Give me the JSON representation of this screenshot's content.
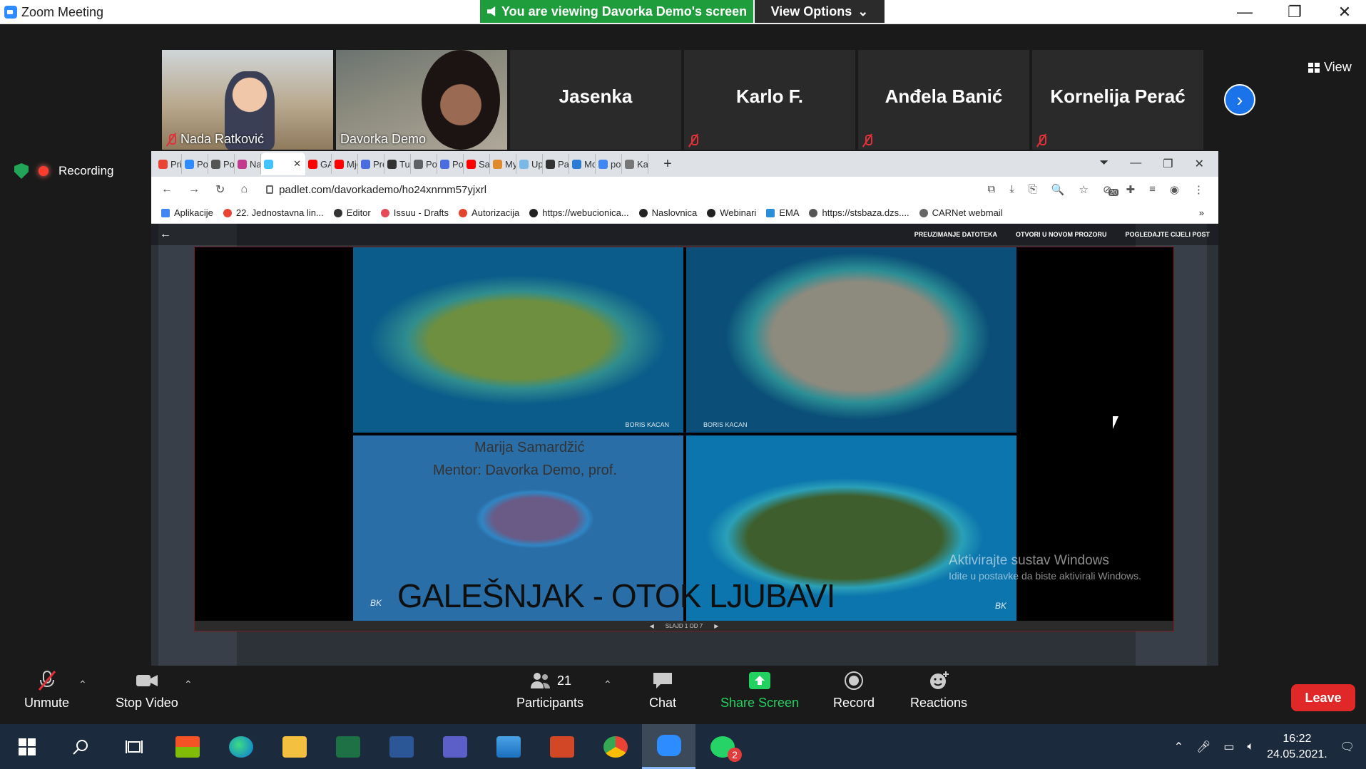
{
  "window": {
    "title": "Zoom Meeting",
    "controls": [
      "—",
      "❐",
      "✕"
    ]
  },
  "banner": {
    "viewing_text": "You are viewing Davorka Demo's screen",
    "view_options": "View Options",
    "view_options_caret": "⌄"
  },
  "view_button": {
    "label": "View"
  },
  "participants": [
    {
      "name": "Nada Ratković",
      "muted": true,
      "video": true
    },
    {
      "name": "Davorka Demo",
      "muted": false,
      "video": true,
      "active": true
    },
    {
      "name": "Jasenka",
      "muted": false,
      "video": false
    },
    {
      "name": "Karlo F.",
      "muted": true,
      "video": false
    },
    {
      "name": "Anđela Banić",
      "muted": true,
      "video": false
    },
    {
      "name": "Kornelija Perać",
      "muted": true,
      "video": false
    }
  ],
  "next_arrow": "›",
  "recording": {
    "label": "Recording"
  },
  "browser": {
    "tabs": [
      "Pris",
      "Pos",
      "Poš",
      "Nac",
      "",
      "GAS",
      "Mje",
      "Pro",
      "Turi",
      "Pov",
      "Poč",
      "Sad",
      "My",
      "Upr",
      "Pan",
      "Moj",
      "pov",
      "Kali"
    ],
    "active_tab_close": "✕",
    "new_tab": "+",
    "tabstrip_extra": [
      "⏷",
      "—",
      "❐",
      "✕"
    ],
    "nav": [
      "←",
      "→",
      "↻",
      "⌂"
    ],
    "url": "padlet.com/davorkademo/ho24xnrnm57yjxrl",
    "addr_icons": [
      "⧉",
      "⤓",
      "⎘",
      "🔍",
      "☆",
      "⊘",
      "✚",
      "≡",
      "◉",
      "⋮"
    ],
    "ext_badge": "20",
    "bookmarks": [
      "Aplikacije",
      "22. Jednostavna lin...",
      "Editor",
      "Issuu - Drafts",
      "Autorizacija",
      "https://webucionica...",
      "Naslovnica",
      "Webinari",
      "EMA",
      "https://stsbaza.dzs....",
      "CARNet webmail"
    ],
    "bookmarks_more": "»"
  },
  "padlet": {
    "back": "←",
    "actions": [
      "PREUZIMANJE DATOTEKA",
      "OTVORI U NOVOM PROZORU",
      "POGLEDAJTE CIJELI POST"
    ],
    "slide": {
      "author": "Marija Samardžić",
      "mentor": "Mentor: Davorka Demo, prof.",
      "headline": "GALEŠNJAK - OTOK LJUBAVI",
      "watermark": "BORIS KACAN",
      "monogram": "BK",
      "counter": "SLAJD 1 OD 7"
    }
  },
  "activation": {
    "line1": "Aktivirajte sustav Windows",
    "line2": "Idite u postavke da biste aktivirali Windows."
  },
  "toolbar": {
    "unmute": "Unmute",
    "stop_video": "Stop Video",
    "participants": "Participants",
    "participants_count": "21",
    "chat": "Chat",
    "share": "Share Screen",
    "record": "Record",
    "reactions": "Reactions",
    "leave": "Leave"
  },
  "taskbar": {
    "apps": [
      "start",
      "search",
      "task-view",
      "store",
      "edge",
      "explorer",
      "excel",
      "word",
      "teams",
      "photos",
      "powerpoint",
      "chrome",
      "zoom",
      "whatsapp"
    ],
    "whatsapp_badge": "2",
    "time": "16:22",
    "date": "24.05.2021."
  },
  "colors": {
    "zoom_blue": "#2d8cff",
    "banner_green": "#1f9d3c",
    "leave_red": "#e02828",
    "taskbar": "#1b2a3d"
  }
}
